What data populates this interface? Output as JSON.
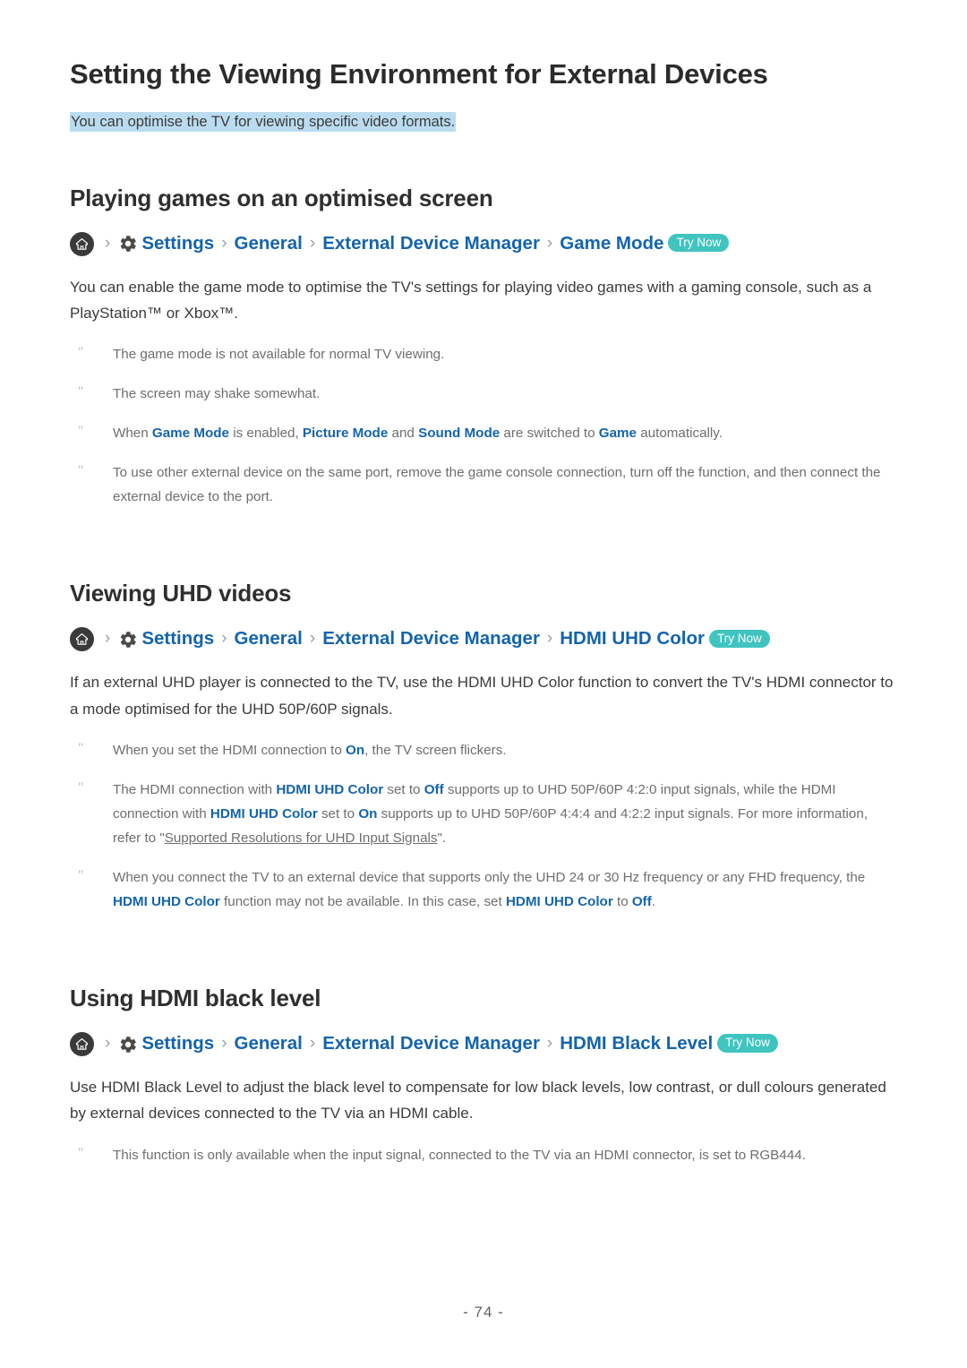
{
  "document": {
    "title": "Setting the Viewing Environment for External Devices",
    "intro": "You can optimise the TV for viewing specific video formats.",
    "page_number": "- 74 -",
    "link_color": "#1464ad",
    "badge_color": "#3fc4c0",
    "highlight_color": "#bbdcf0",
    "note_marker": "\""
  },
  "breadcrumb_common": {
    "home_icon": "home-icon",
    "gear_icon": "gear-icon",
    "separator": "›",
    "settings": "Settings",
    "general": "General",
    "external_device_manager": "External Device Manager",
    "try_now": "Try Now"
  },
  "sections": [
    {
      "heading": "Playing games on an optimised screen",
      "breadcrumb_last": "Game Mode",
      "paragraph": "You can enable the game mode to optimise the TV's settings for playing video games with a gaming console, such as a PlayStation™ or Xbox™.",
      "notes": [
        {
          "parts": [
            {
              "text": "The game mode is not available for normal TV viewing.",
              "style": "plain"
            }
          ]
        },
        {
          "parts": [
            {
              "text": "The screen may shake somewhat.",
              "style": "plain"
            }
          ]
        },
        {
          "parts": [
            {
              "text": "When ",
              "style": "plain"
            },
            {
              "text": "Game Mode",
              "style": "keyword"
            },
            {
              "text": " is enabled, ",
              "style": "plain"
            },
            {
              "text": "Picture Mode",
              "style": "keyword"
            },
            {
              "text": " and ",
              "style": "plain"
            },
            {
              "text": "Sound Mode",
              "style": "keyword"
            },
            {
              "text": " are switched to ",
              "style": "plain"
            },
            {
              "text": "Game",
              "style": "keyword"
            },
            {
              "text": " automatically.",
              "style": "plain"
            }
          ]
        },
        {
          "parts": [
            {
              "text": "To use other external device on the same port, remove the game console connection, turn off the function, and then connect the external device to the port.",
              "style": "plain"
            }
          ]
        }
      ]
    },
    {
      "heading": "Viewing UHD videos",
      "breadcrumb_last": "HDMI UHD Color",
      "paragraph": "If an external UHD player is connected to the TV, use the HDMI UHD Color function to convert the TV's HDMI connector to a mode optimised for the UHD 50P/60P signals.",
      "notes": [
        {
          "parts": [
            {
              "text": "When you set the HDMI connection to ",
              "style": "plain"
            },
            {
              "text": "On",
              "style": "keyword"
            },
            {
              "text": ", the TV screen flickers.",
              "style": "plain"
            }
          ]
        },
        {
          "parts": [
            {
              "text": "The HDMI connection with ",
              "style": "plain"
            },
            {
              "text": "HDMI UHD Color",
              "style": "keyword"
            },
            {
              "text": " set to ",
              "style": "plain"
            },
            {
              "text": "Off",
              "style": "keyword"
            },
            {
              "text": " supports up to UHD 50P/60P 4:2:0 input signals, while the HDMI connection with ",
              "style": "plain"
            },
            {
              "text": "HDMI UHD Color",
              "style": "keyword"
            },
            {
              "text": " set to ",
              "style": "plain"
            },
            {
              "text": "On",
              "style": "keyword"
            },
            {
              "text": " supports up to UHD 50P/60P 4:4:4 and 4:2:2 input signals. For more information, refer to \"",
              "style": "plain"
            },
            {
              "text": "Supported Resolutions for UHD Input Signals",
              "style": "xref"
            },
            {
              "text": "\".",
              "style": "plain"
            }
          ]
        },
        {
          "parts": [
            {
              "text": "When you connect the TV to an external device that supports only the UHD 24 or 30 Hz frequency or any FHD frequency, the ",
              "style": "plain"
            },
            {
              "text": "HDMI UHD Color",
              "style": "keyword"
            },
            {
              "text": " function may not be available. In this case, set ",
              "style": "plain"
            },
            {
              "text": "HDMI UHD Color",
              "style": "keyword"
            },
            {
              "text": " to ",
              "style": "plain"
            },
            {
              "text": "Off",
              "style": "keyword"
            },
            {
              "text": ".",
              "style": "plain"
            }
          ]
        }
      ]
    },
    {
      "heading": "Using HDMI black level",
      "breadcrumb_last": "HDMI Black Level",
      "paragraph": "Use HDMI Black Level to adjust the black level to compensate for low black levels, low contrast, or dull colours generated by external devices connected to the TV via an HDMI cable.",
      "notes": [
        {
          "parts": [
            {
              "text": "This function is only available when the input signal, connected to the TV via an HDMI connector, is set to RGB444.",
              "style": "plain"
            }
          ]
        }
      ]
    }
  ]
}
